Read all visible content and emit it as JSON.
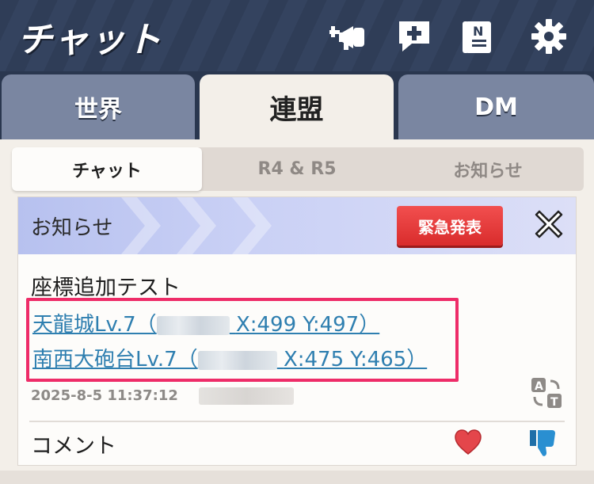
{
  "header": {
    "title": "チャット",
    "icons": [
      "add-megaphone-icon",
      "add-chat-icon",
      "notice-board-icon",
      "gear-icon"
    ]
  },
  "tabs": [
    {
      "label": "世界",
      "active": false
    },
    {
      "label": "連盟",
      "active": true
    },
    {
      "label": "DM",
      "active": false
    }
  ],
  "subtabs": [
    {
      "label": "チャット",
      "active": true
    },
    {
      "label": "R4 & R5",
      "active": false
    },
    {
      "label": "お知らせ",
      "active": false
    }
  ],
  "message": {
    "header_title": "お知らせ",
    "urgent_label": "緊急発表",
    "title": "座標追加テスト",
    "links": [
      {
        "prefix": "天龍城Lv.7（",
        "coords": "X:499  Y:497）"
      },
      {
        "prefix": "南西大砲台Lv.7（",
        "coords": "X:475  Y:465）"
      }
    ],
    "timestamp": "2025-8-5 11:37:12",
    "comment_label": "コメント"
  },
  "colors": {
    "header_bg": "#2f3d57",
    "tab_inactive": "#7a86a1",
    "urgent": "#e03535",
    "highlight": "#ee2c68",
    "link": "#2f7fb0",
    "like": "#e4464b",
    "dislike": "#2a8fd1"
  }
}
